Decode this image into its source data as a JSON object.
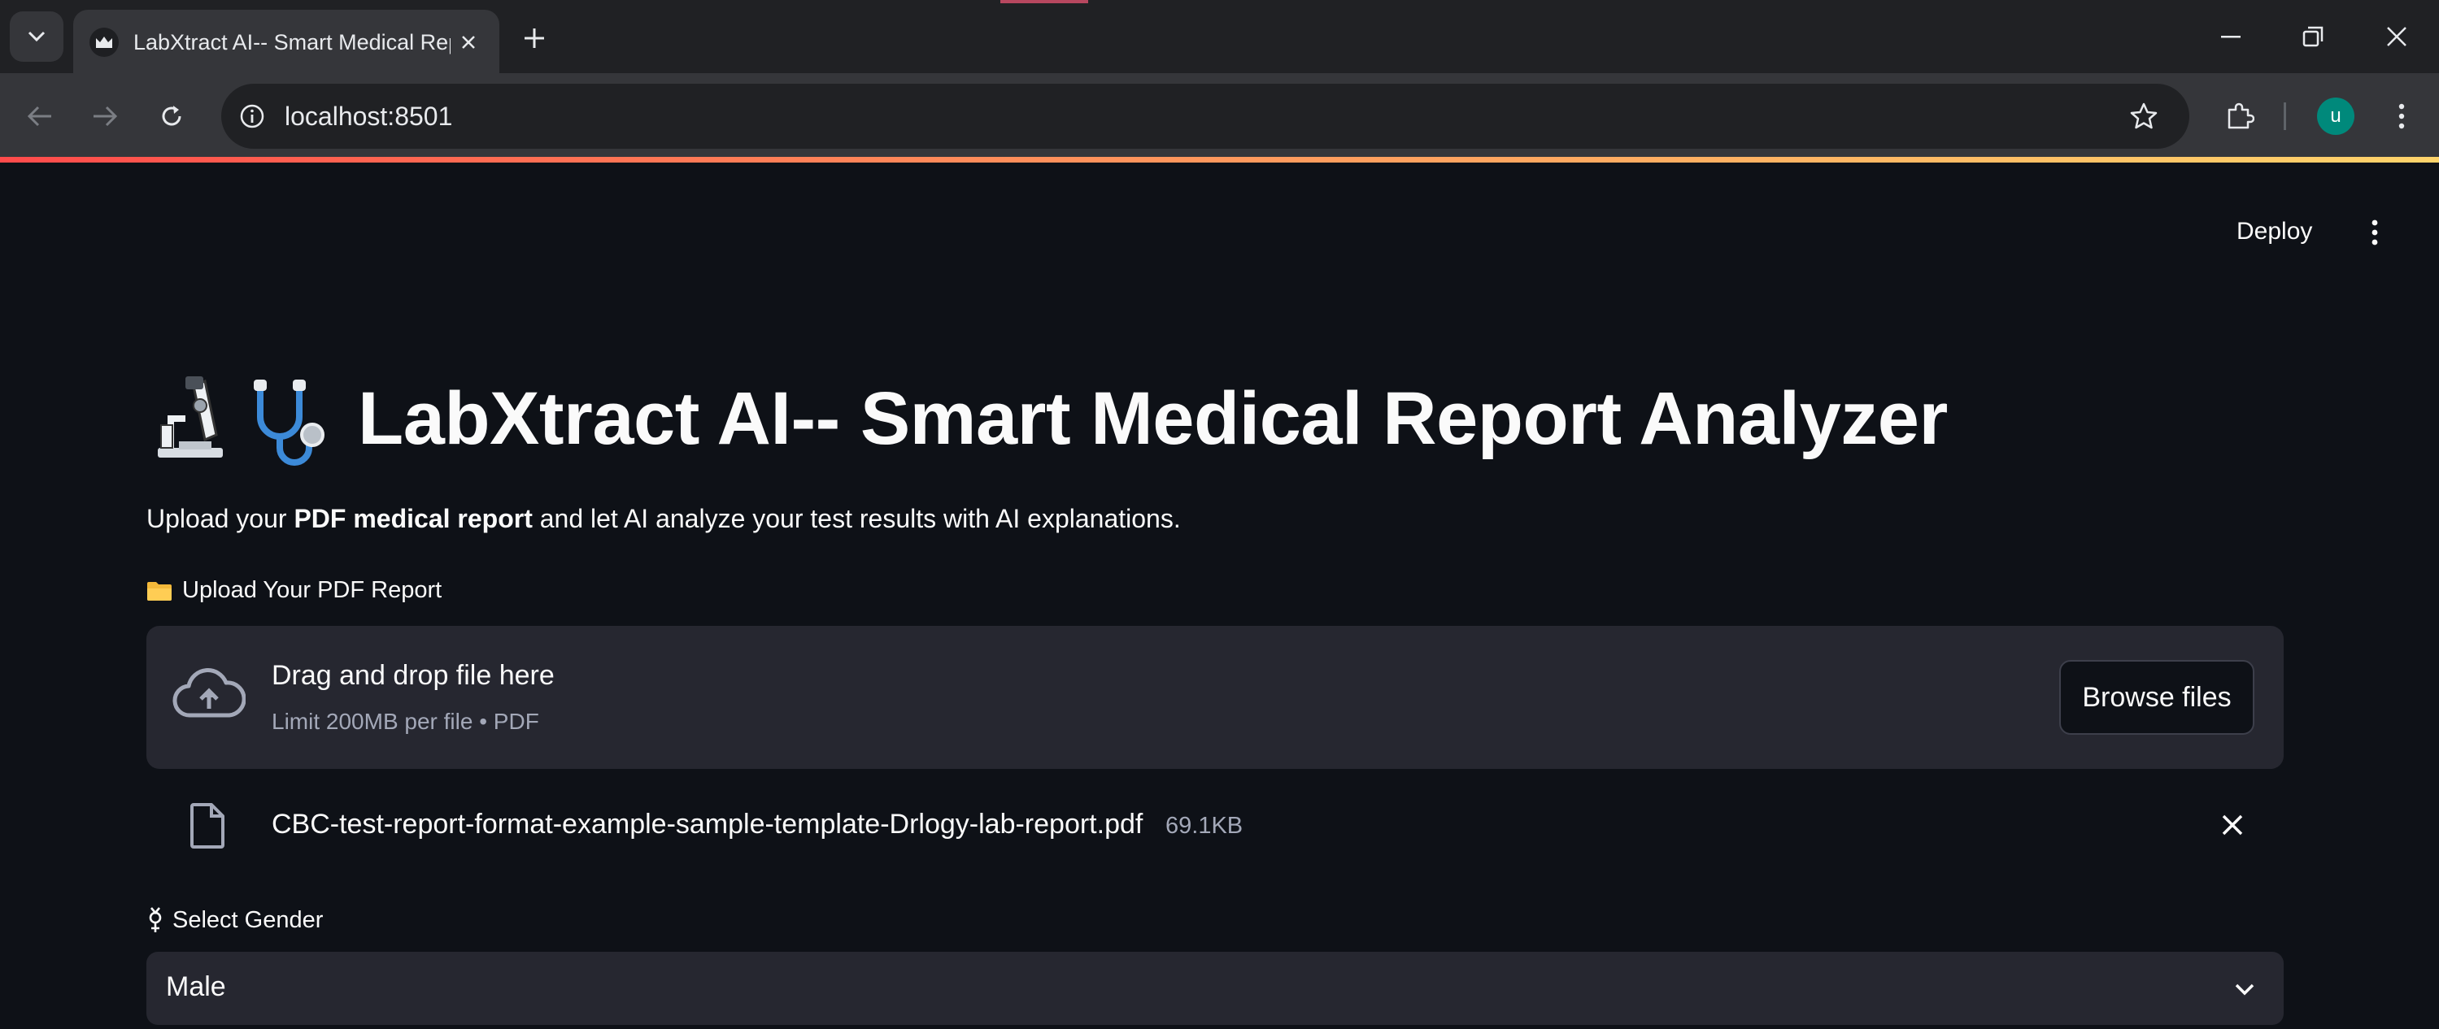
{
  "browser": {
    "tab_title": "LabXtract AI-- Smart Medical Report Analyzer",
    "url": "localhost:8501",
    "profile_initial": "u",
    "accent_gradient": [
      "#ff4b4b",
      "#ffd46b"
    ]
  },
  "header": {
    "deploy_label": "Deploy"
  },
  "main": {
    "title": "LabXtract AI-- Smart Medical Report Analyzer",
    "subtitle_prefix": "Upload your ",
    "subtitle_bold": "PDF medical report",
    "subtitle_suffix": " and let AI analyze your test results with AI explanations.",
    "uploader": {
      "label": "Upload Your PDF Report",
      "drop_title": "Drag and drop file here",
      "limit": "Limit 200MB per file • PDF",
      "browse_label": "Browse files"
    },
    "uploaded_file": {
      "name": "CBC-test-report-format-example-sample-template-Drlogy-lab-report.pdf",
      "size": "69.1KB"
    },
    "gender": {
      "label": "Select Gender",
      "selected": "Male"
    }
  },
  "icons": {
    "title_emojis": [
      "microscope-icon",
      "stethoscope-icon"
    ],
    "upload_label_icon": "folder-icon",
    "gender_label_icon": "transgender-symbol-icon"
  },
  "colors": {
    "background": "#0e1117",
    "widget_bg": "#262730",
    "text": "#fafafa",
    "muted_text": "#a3a8b8"
  }
}
